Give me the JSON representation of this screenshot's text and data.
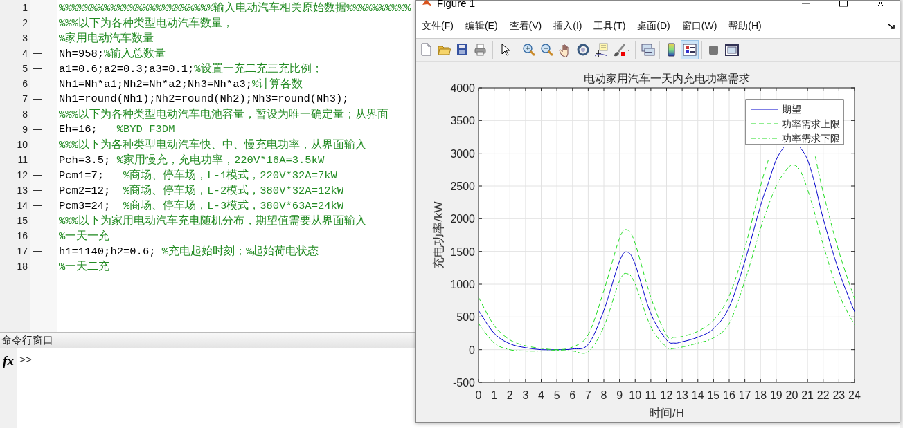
{
  "editor": {
    "lines": [
      {
        "number": "1",
        "executable": false,
        "comment": "%%%%%%%%%%%%%%%%%%%%%%%%输入电动汽车相关原始数据%%%%%%%%%%"
      },
      {
        "number": "2",
        "executable": false,
        "comment": "%%%以下为各种类型电动汽车数量，"
      },
      {
        "number": "3",
        "executable": false,
        "comment": "%家用电动汽车数量"
      },
      {
        "number": "4",
        "executable": true,
        "code": "Nh=958;",
        "comment": "%输入总数量"
      },
      {
        "number": "5",
        "executable": true,
        "code": "a1=0.6;a2=0.3;a3=0.1;",
        "comment": "%设置一充二充三充比例；"
      },
      {
        "number": "6",
        "executable": true,
        "code": "Nh1=Nh*a1;Nh2=Nh*a2;Nh3=Nh*a3;",
        "comment": "%计算各数"
      },
      {
        "number": "7",
        "executable": true,
        "code": "Nh1=round(Nh1);Nh2=round(Nh2);Nh3=round(Nh3);"
      },
      {
        "number": "8",
        "executable": false,
        "comment": "%%%以下为各种类型电动汽车电池容量，暂设为唯一确定量；从界面"
      },
      {
        "number": "9",
        "executable": true,
        "code": "Eh=16;   ",
        "comment": "%BYD F3DM"
      },
      {
        "number": "10",
        "executable": false,
        "comment": "%%%以下为各种类型电动汽车快、中、慢充电功率，从界面输入"
      },
      {
        "number": "11",
        "executable": true,
        "code": "Pch=3.5; ",
        "comment": "%家用慢充，充电功率，220V*16A=3.5kW"
      },
      {
        "number": "12",
        "executable": true,
        "code": "Pcm1=7;   ",
        "comment": "%商场、停车场，L-1模式，220V*32A=7kW"
      },
      {
        "number": "13",
        "executable": true,
        "code": "Pcm2=12;  ",
        "comment": "%商场、停车场，L-2模式，380V*32A=12kW"
      },
      {
        "number": "14",
        "executable": true,
        "code": "Pcm3=24;  ",
        "comment": "%商场、停车场，L-3模式，380V*63A=24kW"
      },
      {
        "number": "15",
        "executable": false,
        "comment": "%%%以下为家用电动汽车充电随机分布，期望值需要从界面输入"
      },
      {
        "number": "16",
        "executable": false,
        "comment": "%一天一充"
      },
      {
        "number": "17",
        "executable": true,
        "code": "h1=1140;h2=0.6; ",
        "comment": "%充电起始时刻；%起始荷电状态"
      },
      {
        "number": "18",
        "executable": false,
        "comment": "%一天二充"
      }
    ]
  },
  "command_window": {
    "title": "命令行窗口",
    "function_button": "fx",
    "prompt": ">>"
  },
  "figure": {
    "title": "Figure 1",
    "menu": [
      "文件(F)",
      "编辑(E)",
      "查看(V)",
      "插入(I)",
      "工具(T)",
      "桌面(D)",
      "窗口(W)",
      "帮助(H)"
    ],
    "toolbar": [
      {
        "pressed": false
      },
      {
        "pressed": false
      },
      {
        "pressed": false
      },
      {
        "pressed": false
      },
      {
        "pressed": false
      },
      {
        "pressed": false
      },
      {
        "pressed": false
      },
      {
        "pressed": false
      },
      {
        "pressed": false
      },
      {
        "pressed": false
      },
      {
        "pressed": false
      },
      {
        "pressed": false
      },
      {
        "pressed": false
      },
      {
        "pressed": true
      },
      {
        "pressed": false
      },
      {
        "pressed": false
      }
    ],
    "chart_data": {
      "type": "line",
      "title": "电动家用汽车一天内充电功率需求",
      "xlabel": "时间/H",
      "ylabel": "充电功率/kW",
      "grid": true,
      "legend": true,
      "x": [
        0,
        1,
        2,
        3,
        4,
        5,
        6,
        7,
        8,
        9,
        9.5,
        10,
        11,
        12,
        12.5,
        13,
        14,
        15,
        16,
        17,
        18,
        18.5,
        19,
        19.5,
        20,
        20.5,
        21,
        21.5,
        22,
        23,
        24
      ],
      "series": [
        {
          "name": "期望",
          "color": "#0000cc",
          "line_style": "solid",
          "values": [
            600,
            250,
            90,
            30,
            0,
            0,
            10,
            80,
            600,
            1350,
            1490,
            1300,
            550,
            150,
            100,
            120,
            190,
            320,
            650,
            1350,
            2200,
            2550,
            2900,
            3100,
            null,
            3100,
            2900,
            2500,
            2000,
            1200,
            580
          ]
        },
        {
          "name": "功率需求上限",
          "color": "#22dd22",
          "line_style": "dashed",
          "values": [
            800,
            370,
            150,
            60,
            20,
            0,
            40,
            230,
            900,
            1700,
            1830,
            1620,
            800,
            220,
            190,
            200,
            280,
            450,
            820,
            1550,
            2500,
            2900,
            null,
            null,
            null,
            null,
            null,
            2950,
            2400,
            1500,
            780
          ]
        },
        {
          "name": "功率需求下限",
          "color": "#22dd22",
          "line_style": "dashdot",
          "values": [
            400,
            100,
            0,
            -20,
            -20,
            -10,
            -20,
            -30,
            350,
            1050,
            1160,
            1000,
            350,
            40,
            20,
            40,
            100,
            180,
            400,
            1050,
            1850,
            2200,
            2500,
            2700,
            2820,
            2750,
            2450,
            2050,
            1600,
            850,
            380
          ]
        }
      ],
      "xlim": [
        0,
        24
      ],
      "ylim": [
        -500,
        4000
      ],
      "xticks": [
        {
          "value": 0,
          "label": "0"
        },
        {
          "value": 1,
          "label": "1"
        },
        {
          "value": 2,
          "label": "2"
        },
        {
          "value": 3,
          "label": "3"
        },
        {
          "value": 4,
          "label": "4"
        },
        {
          "value": 5,
          "label": "5"
        },
        {
          "value": 6,
          "label": "6"
        },
        {
          "value": 7,
          "label": "7"
        },
        {
          "value": 8,
          "label": "8"
        },
        {
          "value": 9,
          "label": "9"
        },
        {
          "value": 10,
          "label": "10"
        },
        {
          "value": 11,
          "label": "11"
        },
        {
          "value": 12,
          "label": "12"
        },
        {
          "value": 13,
          "label": "13"
        },
        {
          "value": 14,
          "label": "14"
        },
        {
          "value": 15,
          "label": "15"
        },
        {
          "value": 16,
          "label": "16"
        },
        {
          "value": 17,
          "label": "17"
        },
        {
          "value": 18,
          "label": "18"
        },
        {
          "value": 19,
          "label": "19"
        },
        {
          "value": 20,
          "label": "20"
        },
        {
          "value": 21,
          "label": "21"
        },
        {
          "value": 22,
          "label": "22"
        },
        {
          "value": 23,
          "label": "23"
        },
        {
          "value": 24,
          "label": "24"
        }
      ],
      "yticks": [
        {
          "value": -500,
          "label": "-500"
        },
        {
          "value": 0,
          "label": "0"
        },
        {
          "value": 500,
          "label": "500"
        },
        {
          "value": 1000,
          "label": "1000"
        },
        {
          "value": 1500,
          "label": "1500"
        },
        {
          "value": 2000,
          "label": "2000"
        },
        {
          "value": 2500,
          "label": "2500"
        },
        {
          "value": 3000,
          "label": "3000"
        },
        {
          "value": 3500,
          "label": "3500"
        },
        {
          "value": 4000,
          "label": "4000"
        }
      ]
    }
  }
}
